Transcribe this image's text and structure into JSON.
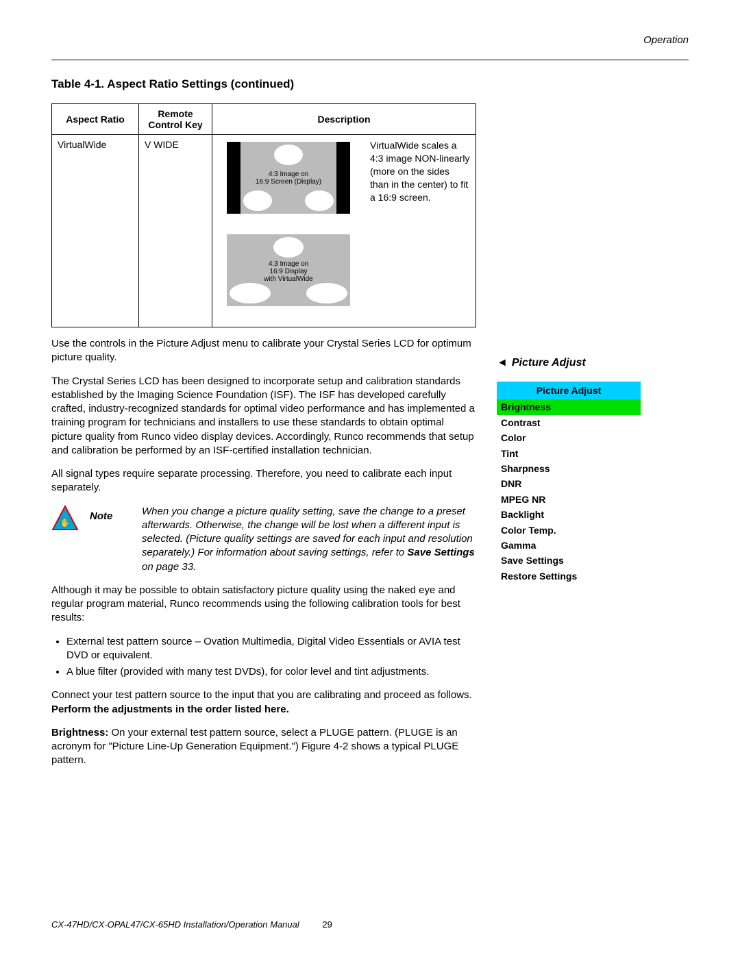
{
  "header": {
    "section": "Operation"
  },
  "table": {
    "title": "Table 4-1. Aspect Ratio Settings (continued)",
    "headers": {
      "c1": "Aspect Ratio",
      "c2": "Remote Control Key",
      "c3": "Description"
    },
    "row": {
      "aspect": "VirtualWide",
      "key": "V WIDE",
      "diagram1_caption_l1": "4:3 Image on",
      "diagram1_caption_l2": "16:9 Screen (Display)",
      "diagram2_caption_l1": "4:3 Image on",
      "diagram2_caption_l2": "16:9 Display",
      "diagram2_caption_l3": "with VirtualWide",
      "desc": "VirtualWide scales a 4:3 image NON-linearly (more on the sides than in the center) to fit a 16:9 screen."
    }
  },
  "body": {
    "p1": "Use the controls in the Picture Adjust menu to calibrate your Crystal Series LCD for optimum picture quality.",
    "p2": "The Crystal Series LCD has been designed to incorporate setup and calibration standards established by the Imaging Science Foundation (ISF). The ISF has developed carefully crafted, industry-recognized standards for optimal video performance and has implemented a training program for technicians and installers to use these standards to obtain optimal picture quality from Runco video display devices. Accordingly, Runco recommends that setup and calibration be performed by an ISF-certified installation technician.",
    "p3": "All signal types require separate processing. Therefore, you need to calibrate each input separately.",
    "note_label": "Note",
    "note_text_pre": "When you change a picture quality setting, save the change to a preset afterwards. Otherwise, the change will be lost when a different input is selected. (Picture quality settings are saved for each input and resolution separately.) For information about saving settings, refer to ",
    "note_strong": "Save Settings",
    "note_text_post": " on page 33.",
    "p4": "Although it may be possible to obtain satisfactory picture quality using the naked eye and regular program material, Runco recommends using the following calibration tools for best results:",
    "b1": "External test pattern source – Ovation Multimedia, Digital Video Essentials or AVIA test DVD or equivalent.",
    "b2": "A blue filter (provided with many test DVDs), for color level and tint adjustments.",
    "p5_pre": "Connect your test pattern source to the input that you are calibrating and proceed as follows. ",
    "p5_strong": "Perform the adjustments in the order listed here.",
    "p6_strong": "Brightness:",
    "p6": " On your external test pattern source, select a PLUGE pattern. (PLUGE is an acronym for \"Picture Line-Up Generation Equipment.\") Figure 4-2 shows a typical PLUGE pattern."
  },
  "side": {
    "heading": "Picture Adjust",
    "menu_title": "Picture Adjust",
    "items": [
      "Brightness",
      "Contrast",
      "Color",
      "Tint",
      "Sharpness",
      "DNR",
      "MPEG NR",
      "Backlight",
      "Color Temp.",
      "Gamma",
      "Save Settings",
      "Restore Settings"
    ]
  },
  "footer": {
    "text": "CX-47HD/CX-OPAL47/CX-65HD Installation/Operation Manual",
    "page": "29"
  }
}
